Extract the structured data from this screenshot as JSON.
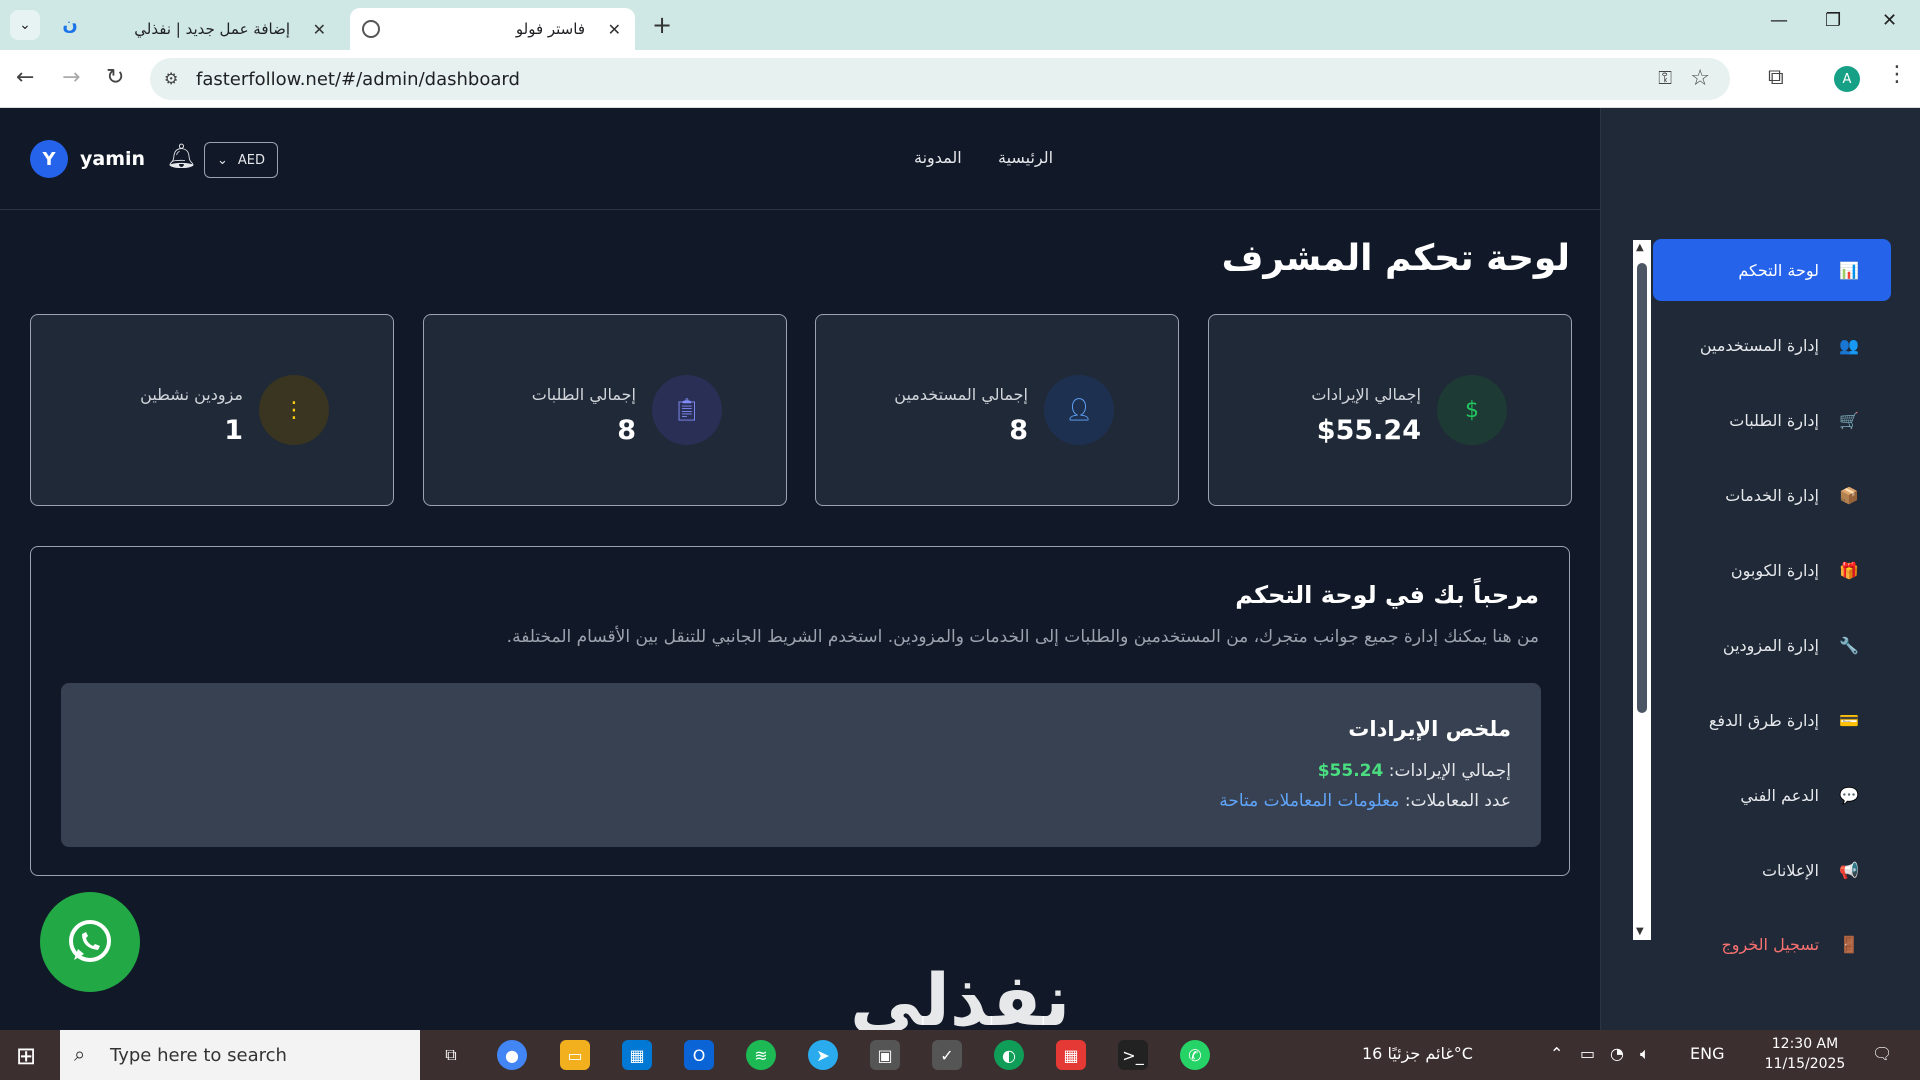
{
  "browser": {
    "tabs": [
      {
        "title": "إضافة عمل جديد | نفذلي"
      },
      {
        "title": "فاستر فولو"
      }
    ],
    "url": "fasterfollow.net/#/admin/dashboard",
    "profile_initial": "A"
  },
  "topnav": {
    "avatar_initial": "Y",
    "username": "yamin",
    "currency": "AED",
    "links": [
      "الرئيسية",
      "المدونة"
    ]
  },
  "page_title": "لوحة تحكم المشرف",
  "stats": [
    {
      "label": "إجمالي الإيرادات",
      "value": "$55.24",
      "icon": "dollar-icon",
      "color": "#22c55e"
    },
    {
      "label": "إجمالي المستخدمين",
      "value": "8",
      "icon": "users-icon",
      "color": "#60a5fa"
    },
    {
      "label": "إجمالي الطلبات",
      "value": "8",
      "icon": "clipboard-icon",
      "color": "#818cf8"
    },
    {
      "label": "مزودين نشطين",
      "value": "1",
      "icon": "traffic-light-icon",
      "color": "#facc15"
    }
  ],
  "welcome": {
    "title": "مرحباً بك في لوحة التحكم",
    "description": "من هنا يمكنك إدارة جميع جوانب متجرك، من المستخدمين والطلبات إلى الخدمات والمزودين. استخدم الشريط الجانبي للتنقل بين الأقسام المختلفة."
  },
  "summary": {
    "title": "ملخص الإيرادات",
    "revenue_label": "إجمالي الإيرادات:",
    "revenue_value": "55.24$",
    "transactions_label": "عدد المعاملات:",
    "transactions_value": "معلومات المعاملات متاحة"
  },
  "sidebar": {
    "items": [
      {
        "label": "لوحة التحكم",
        "icon": "📊",
        "active": true
      },
      {
        "label": "إدارة المستخدمين",
        "icon": "👥",
        "active": false
      },
      {
        "label": "إدارة الطلبات",
        "icon": "🛒",
        "active": false
      },
      {
        "label": "إدارة الخدمات",
        "icon": "📦",
        "active": false
      },
      {
        "label": "إدارة الكوبون",
        "icon": "🎁",
        "active": false
      },
      {
        "label": "إدارة المزودين",
        "icon": "🔧",
        "active": false
      },
      {
        "label": "إدارة طرق الدفع",
        "icon": "💳",
        "active": false
      },
      {
        "label": "الدعم الفني",
        "icon": "💬",
        "active": false
      },
      {
        "label": "الإعلانات",
        "icon": "📢",
        "active": false
      }
    ],
    "logout": {
      "label": "تسجيل الخروج",
      "icon": "🚪"
    }
  },
  "watermark": "نفذلي",
  "taskbar": {
    "search_placeholder": "Type here to search",
    "weather": "غائم جزئيًا 16°C",
    "lang": "ENG",
    "time": "12:30 AM",
    "date": "11/15/2025"
  }
}
